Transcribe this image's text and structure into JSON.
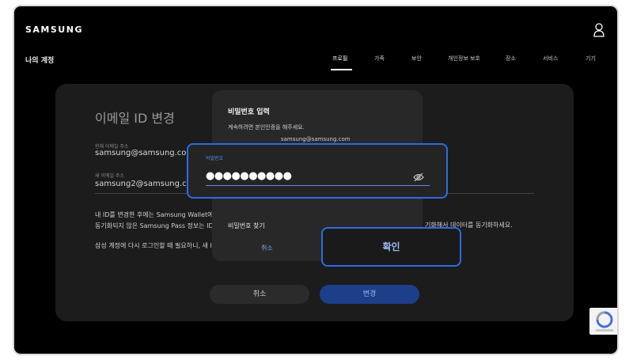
{
  "brand": {
    "logo": "SAMSUNG"
  },
  "header": {
    "page_label": "나의 계정"
  },
  "nav": [
    {
      "label": "프로필",
      "active": true
    },
    {
      "label": "가족"
    },
    {
      "label": "보안"
    },
    {
      "label": "개인정보 보호"
    },
    {
      "label": "장소"
    },
    {
      "label": "서비스"
    },
    {
      "label": "기기"
    }
  ],
  "background": {
    "title": "이메일 ID 변경",
    "current_email_label": "현재 이메일 주소",
    "current_email": "samsung@samsung.com",
    "new_email_label": "새 이메일 주소",
    "new_email": "samsung2@samsung.com",
    "body_line1": "내 ID를 변경한 후에는 Samsung Wallet에 내",
    "body_line2": "동기화되지 않은 Samsung Pass 정보는 ID를",
    "body_line2_right": "기화해서 데이터를 동기화하세요.",
    "body_line3": "삼성 계정에 다시 로그인할 때 필요하니, 새 ID",
    "cancel_label": "취소",
    "change_label": "변경"
  },
  "dialog": {
    "title": "비밀번호 입력",
    "subtitle": "계속하려면 본인인증을 해주세요.",
    "email": "samsung@samsung.com",
    "password_label": "비밀번호",
    "password_value": "●●●●●●●●●●",
    "forgot_label": "비밀번호 찾기",
    "cancel_label": "취소",
    "confirm_label": "확인"
  },
  "colors": {
    "accent": "#2e6be6",
    "background": "#000000",
    "card": "#1c1c1c",
    "dialog": "#282828"
  },
  "icons": {
    "user": "user-icon",
    "eye": "eye-off-icon",
    "recaptcha": "recaptcha-icon"
  }
}
